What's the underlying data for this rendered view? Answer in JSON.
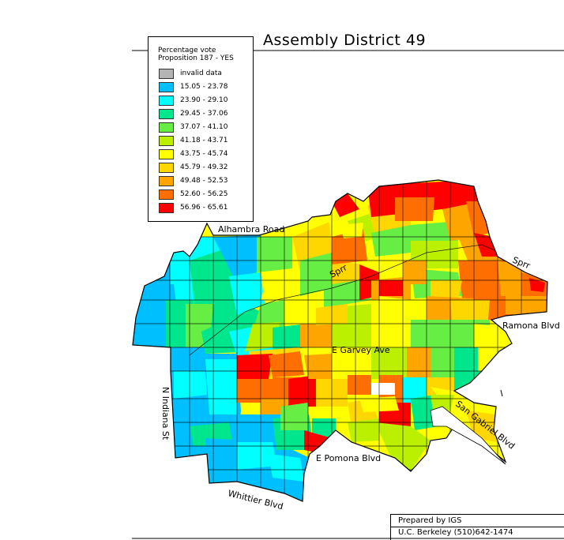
{
  "map": {
    "title": "Assembly District 49",
    "legend": {
      "title_line1": "Percentage vote",
      "title_line2": "Proposition 187 - YES",
      "items": [
        {
          "label": "invalid data",
          "color": "#b4b4b4"
        },
        {
          "label": "15.05 - 23.78",
          "color": "#00bfff"
        },
        {
          "label": "23.90 - 29.10",
          "color": "#00ffff"
        },
        {
          "label": "29.45 - 37.06",
          "color": "#00e68c"
        },
        {
          "label": "37.07 - 41.10",
          "color": "#66ee44"
        },
        {
          "label": "41.18 - 43.71",
          "color": "#bbf000"
        },
        {
          "label": "43.75 - 45.74",
          "color": "#ffff00"
        },
        {
          "label": "45.79 - 49.32",
          "color": "#ffd700"
        },
        {
          "label": "49.48 - 52.53",
          "color": "#ffa500"
        },
        {
          "label": "52.60 - 56.25",
          "color": "#ff6e00"
        },
        {
          "label": "56.96 - 65.61",
          "color": "#ff0000"
        }
      ]
    },
    "streets": {
      "alhambra": "Alhambra Road",
      "sprr_center": "Sprr",
      "sprr_east": "Sprr",
      "ramona": "Ramona Blvd",
      "garvey": "E Garvey Ave",
      "san_gabriel": "San Gabriel Blvd",
      "indiana": "N Indiana St",
      "pomona": "E Pomona Blvd",
      "whittier": "Whittier Blvd"
    },
    "credit": {
      "line1": "Prepared by IGS",
      "line2": "U.C. Berkeley (510)642-1474"
    }
  }
}
